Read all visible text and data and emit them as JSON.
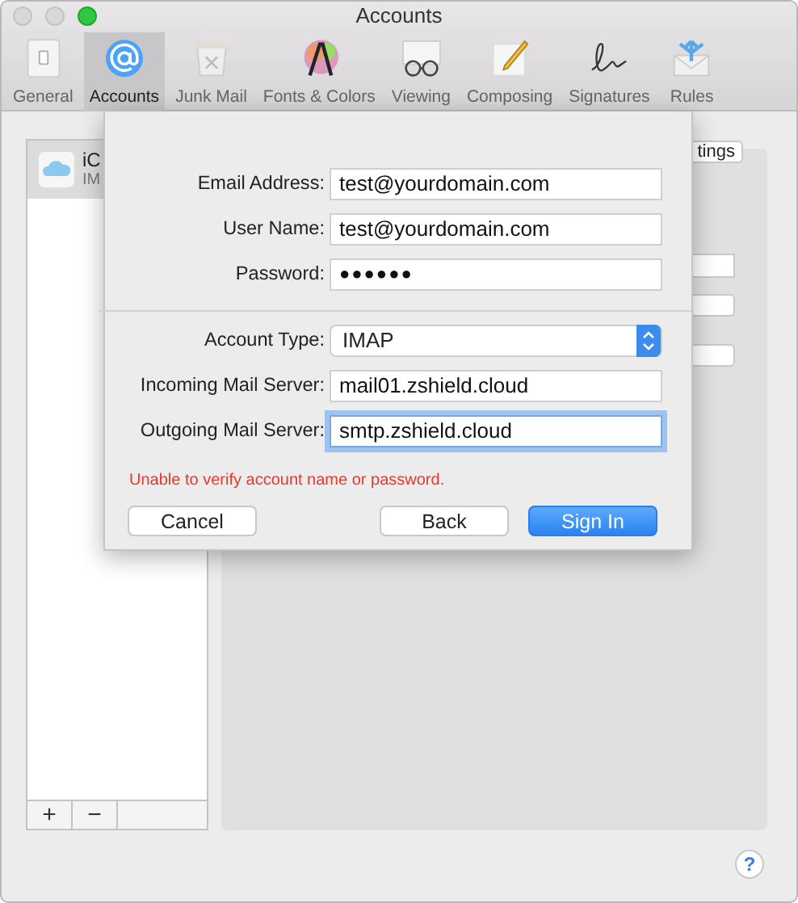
{
  "window": {
    "title": "Accounts"
  },
  "toolbar": [
    {
      "label": "General",
      "selected": false
    },
    {
      "label": "Accounts",
      "selected": true
    },
    {
      "label": "Junk Mail",
      "selected": false
    },
    {
      "label": "Fonts & Colors",
      "selected": false
    },
    {
      "label": "Viewing",
      "selected": false
    },
    {
      "label": "Composing",
      "selected": false
    },
    {
      "label": "Signatures",
      "selected": false
    },
    {
      "label": "Rules",
      "selected": false
    }
  ],
  "accounts_list": {
    "items": [
      {
        "name": "iC",
        "type": "IM",
        "selected": true
      }
    ],
    "buttons": [
      "+",
      "−"
    ]
  },
  "detail": {
    "settings_button": "tings"
  },
  "sheet": {
    "fields": [
      {
        "kind": "text",
        "label": "Email Address:",
        "value": "test@yourdomain.com",
        "focused": false
      },
      {
        "kind": "text",
        "label": "User Name:",
        "value": "test@yourdomain.com",
        "focused": false
      },
      {
        "kind": "password",
        "label": "Password:",
        "value": "●●●●●●",
        "focused": false
      },
      {
        "kind": "select",
        "label": "Account Type:",
        "value": "IMAP",
        "focused": false
      },
      {
        "kind": "text",
        "label": "Incoming Mail Server:",
        "value": "mail01.zshield.cloud",
        "focused": false
      },
      {
        "kind": "text",
        "label": "Outgoing Mail Server:",
        "value": "smtp.zshield.cloud",
        "focused": true
      }
    ],
    "error": "Unable to verify account name or password.",
    "buttons": [
      {
        "label": "Cancel",
        "kind": "normal"
      },
      {
        "label": "Back",
        "kind": "normal"
      },
      {
        "label": "Sign In",
        "kind": "default"
      }
    ]
  },
  "help": "?"
}
